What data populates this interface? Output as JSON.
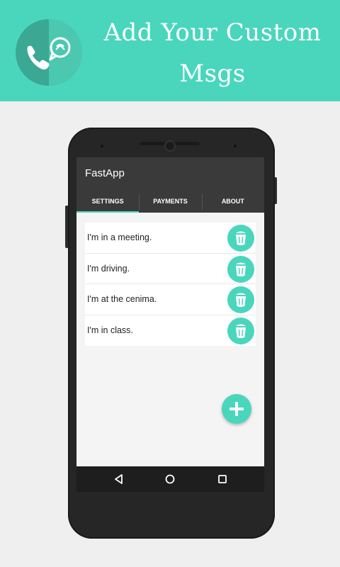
{
  "banner": {
    "title_line1": "Add Your Custom",
    "title_line2": "Msgs",
    "accent_color": "#49d6bd",
    "logo_icons": [
      "phone-icon",
      "chat-bubble-icon"
    ]
  },
  "app": {
    "title": "FastApp",
    "tabs": [
      {
        "label": "SETTINGS",
        "selected": true
      },
      {
        "label": "PAYMENTS",
        "selected": false
      },
      {
        "label": "ABOUT",
        "selected": false
      }
    ],
    "messages": [
      {
        "text": "I'm in a meeting.",
        "action_icon": "trash-icon"
      },
      {
        "text": "I'm driving.",
        "action_icon": "trash-icon"
      },
      {
        "text": "I'm at the cenima.",
        "action_icon": "trash-icon"
      },
      {
        "text": "I'm in class.",
        "action_icon": "trash-icon"
      }
    ],
    "fab_icon": "plus-icon",
    "nav_icons": [
      "back-icon",
      "home-icon",
      "recents-icon"
    ]
  }
}
